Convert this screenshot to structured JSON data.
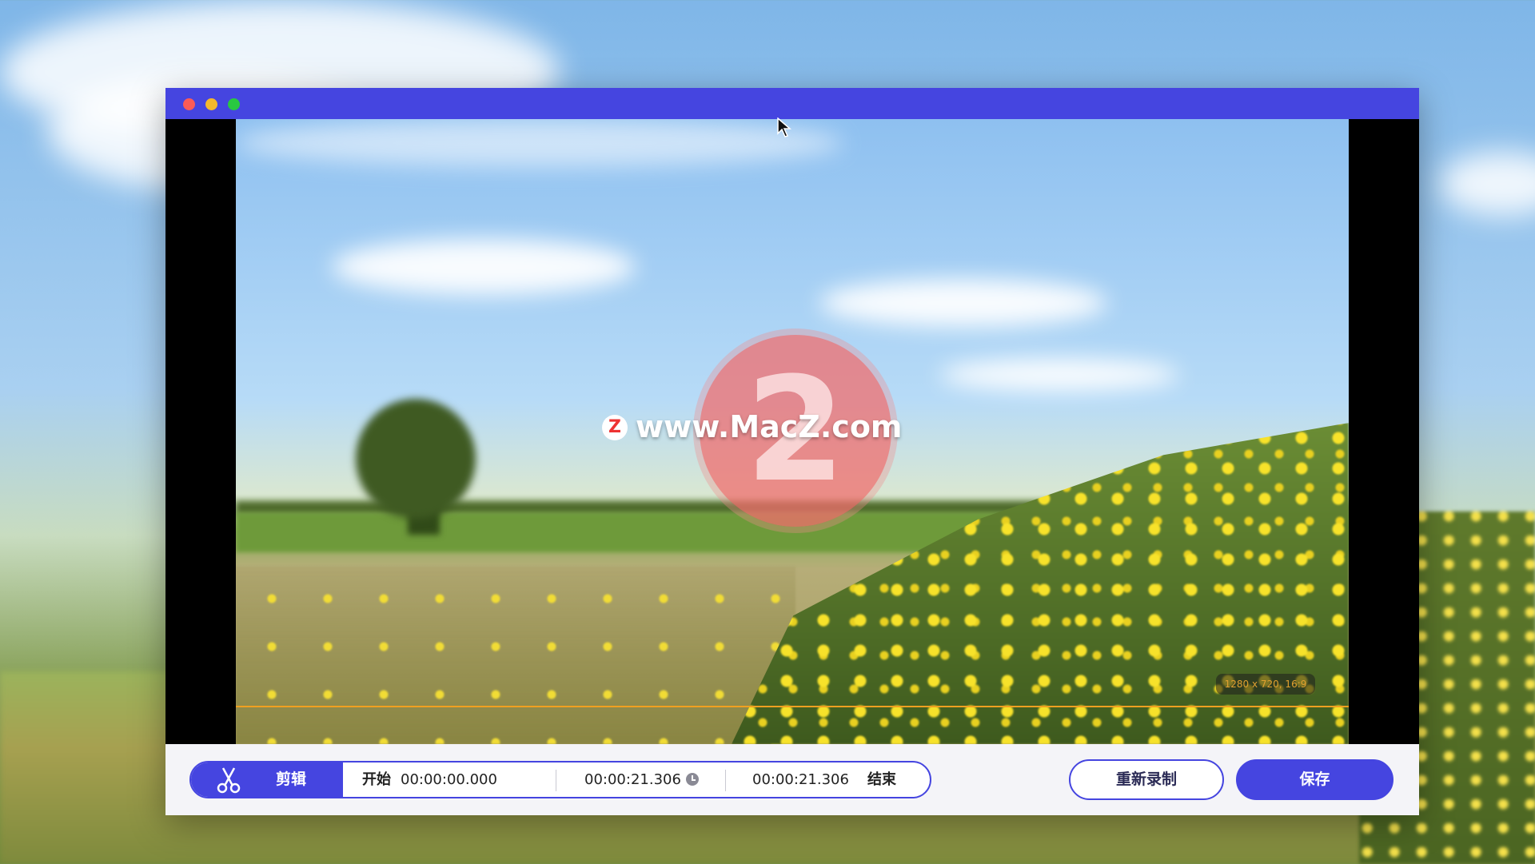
{
  "window": {
    "traffic_lights": [
      "close",
      "minimize",
      "zoom"
    ]
  },
  "video": {
    "dimensions_label": "1280 x 720, 16:9",
    "watermark_text": "www.MacZ.com",
    "watermark_logo": "Z",
    "watermark_badge": "2"
  },
  "controls": {
    "edit_label": "剪辑",
    "start_label": "开始",
    "start_time": "00:00:00.000",
    "duration_time": "00:00:21.306",
    "end_time": "00:00:21.306",
    "end_label": "结束",
    "rerecord_label": "重新录制",
    "save_label": "保存"
  },
  "colors": {
    "accent": "#4545e0",
    "selection": "#f0a020"
  }
}
